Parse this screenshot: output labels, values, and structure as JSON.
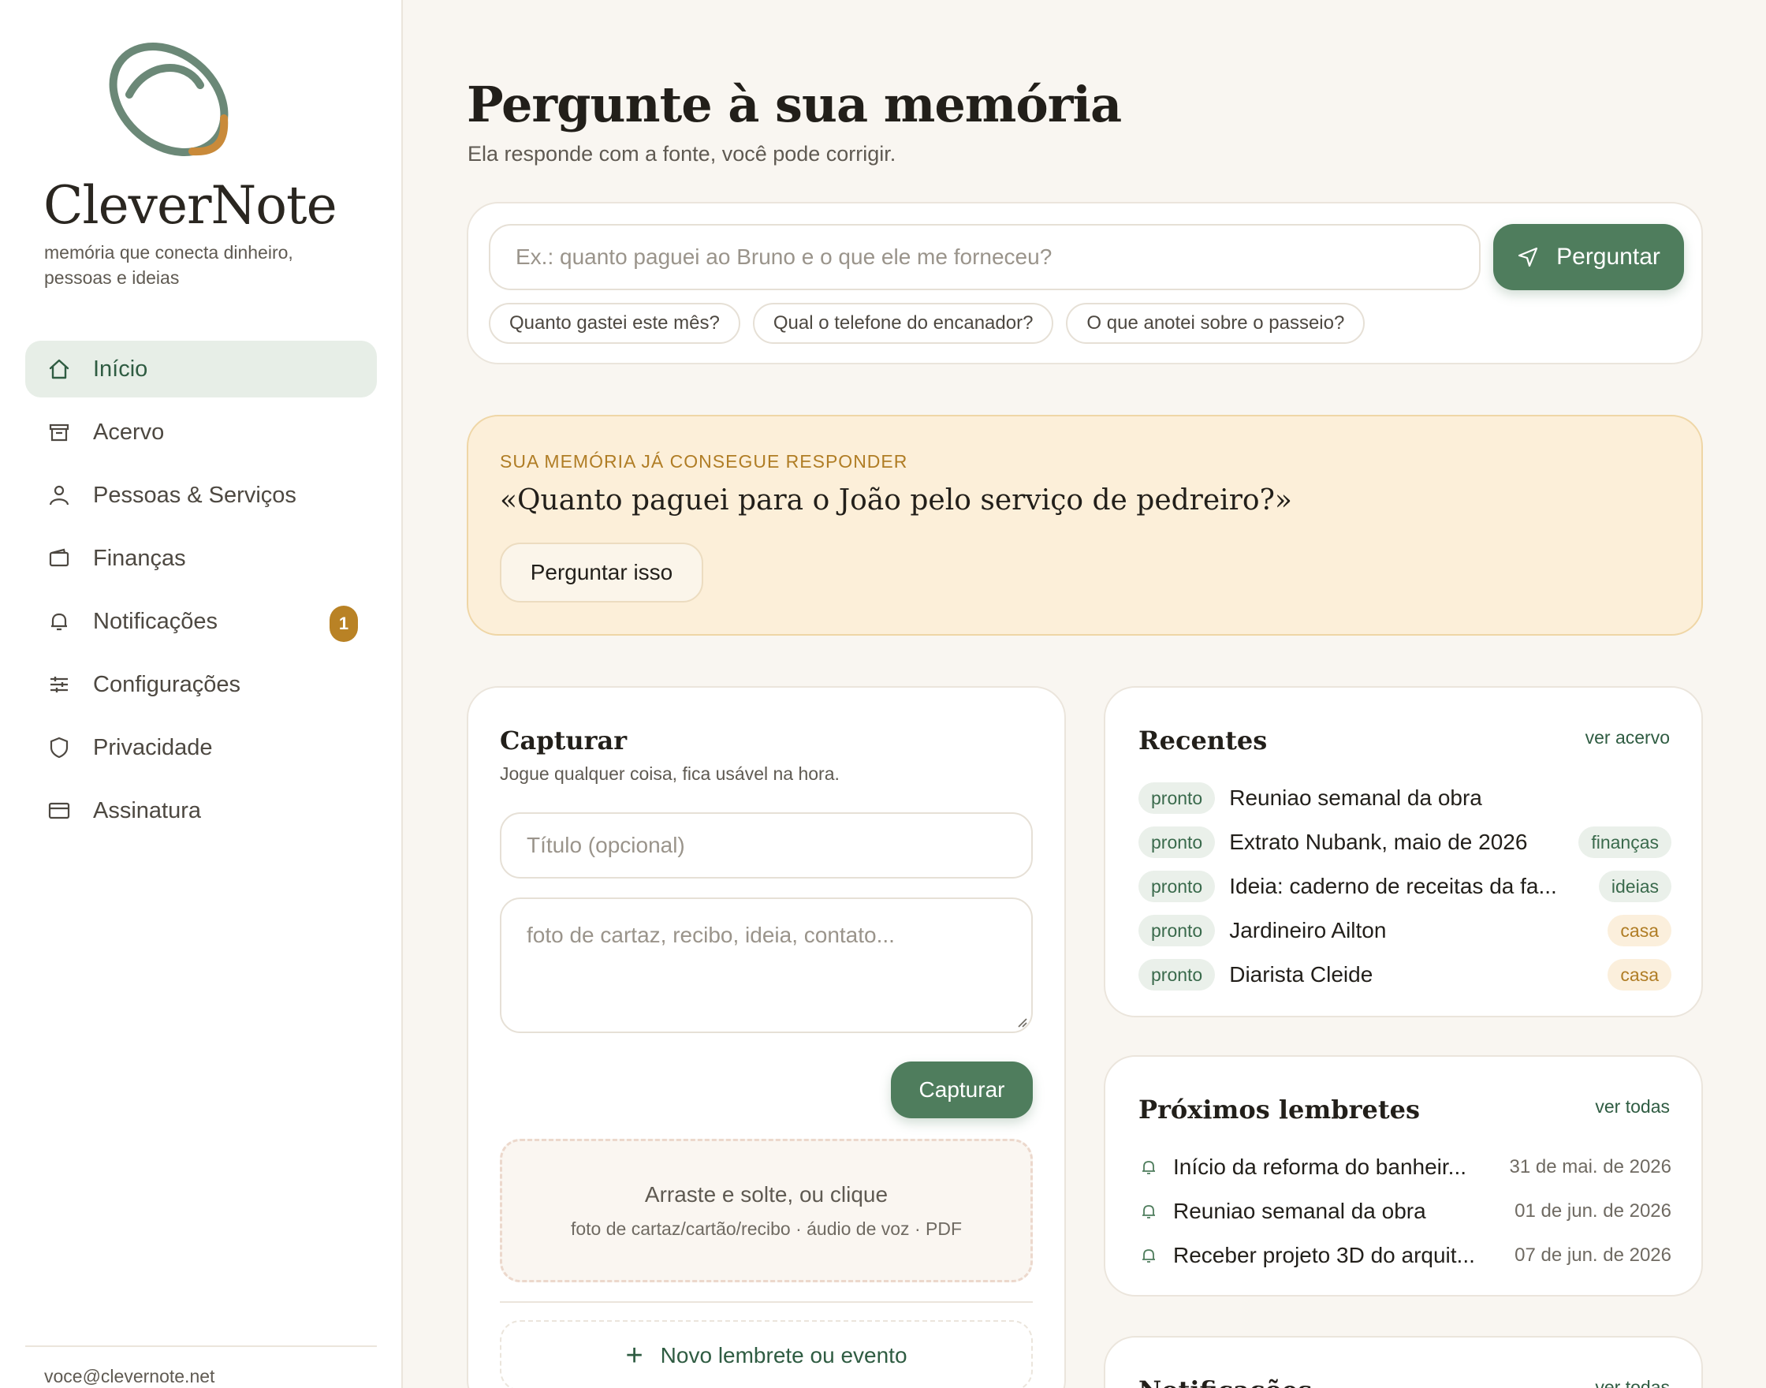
{
  "brand": {
    "name": "CleverNote",
    "tagline": "memória que conecta dinheiro, pessoas e ideias"
  },
  "sidebar": {
    "items": [
      {
        "label": "Início",
        "icon": "home-icon",
        "active": true
      },
      {
        "label": "Acervo",
        "icon": "archive-icon"
      },
      {
        "label": "Pessoas & Serviços",
        "icon": "person-icon"
      },
      {
        "label": "Finanças",
        "icon": "wallet-icon"
      },
      {
        "label": "Notificações",
        "icon": "bell-icon",
        "badge": "1"
      },
      {
        "label": "Configurações",
        "icon": "sliders-icon"
      },
      {
        "label": "Privacidade",
        "icon": "shield-icon"
      },
      {
        "label": "Assinatura",
        "icon": "card-icon"
      }
    ],
    "user_email": "voce@clevernote.net"
  },
  "header": {
    "title": "Pergunte à sua memória",
    "subtitle": "Ela responde com a fonte, você pode corrigir."
  },
  "ask": {
    "placeholder": "Ex.: quanto paguei ao Bruno e o que ele me forneceu?",
    "button_label": "Perguntar",
    "chips": [
      "Quanto gastei este mês?",
      "Qual o telefone do encanador?",
      "O que anotei sobre o passeio?"
    ]
  },
  "suggestion": {
    "kicker": "SUA MEMÓRIA JÁ CONSEGUE RESPONDER",
    "question": "«Quanto paguei para o João pelo serviço de pedreiro?»",
    "button_label": "Perguntar isso"
  },
  "capture": {
    "title": "Capturar",
    "subtitle": "Jogue qualquer coisa, fica usável na hora.",
    "title_placeholder": "Título (opcional)",
    "body_placeholder": "foto de cartaz, recibo, ideia, contato...",
    "button_label": "Capturar",
    "dropzone_main": "Arraste e solte, ou clique",
    "dropzone_sub": "foto de cartaz/cartão/recibo · áudio de voz · PDF",
    "new_reminder_label": "Novo lembrete ou evento"
  },
  "recent": {
    "title": "Recentes",
    "link": "ver acervo",
    "items": [
      {
        "status": "pronto",
        "text": "Reuniao semanal da obra",
        "tag": "",
        "tag_style": ""
      },
      {
        "status": "pronto",
        "text": "Extrato Nubank, maio de 2026",
        "tag": "finanças",
        "tag_style": "green"
      },
      {
        "status": "pronto",
        "text": "Ideia: caderno de receitas da fa...",
        "tag": "ideias",
        "tag_style": "green"
      },
      {
        "status": "pronto",
        "text": "Jardineiro Ailton",
        "tag": "casa",
        "tag_style": "amber"
      },
      {
        "status": "pronto",
        "text": "Diarista Cleide",
        "tag": "casa",
        "tag_style": "amber"
      }
    ]
  },
  "reminders": {
    "title": "Próximos lembretes",
    "link": "ver todas",
    "items": [
      {
        "text": "Início da reforma do banheir...",
        "date": "31 de mai. de 2026"
      },
      {
        "text": "Reuniao semanal da obra",
        "date": "01 de jun. de 2026"
      },
      {
        "text": "Receber projeto 3D do arquit...",
        "date": "07 de jun. de 2026"
      }
    ]
  },
  "notifications": {
    "title": "Notificações",
    "link": "ver todas"
  },
  "colors": {
    "accent": "#4f7d5d",
    "accent_dark": "#2f5c42",
    "badge": "#b98225",
    "suggest_bg": "#fcefd9"
  }
}
